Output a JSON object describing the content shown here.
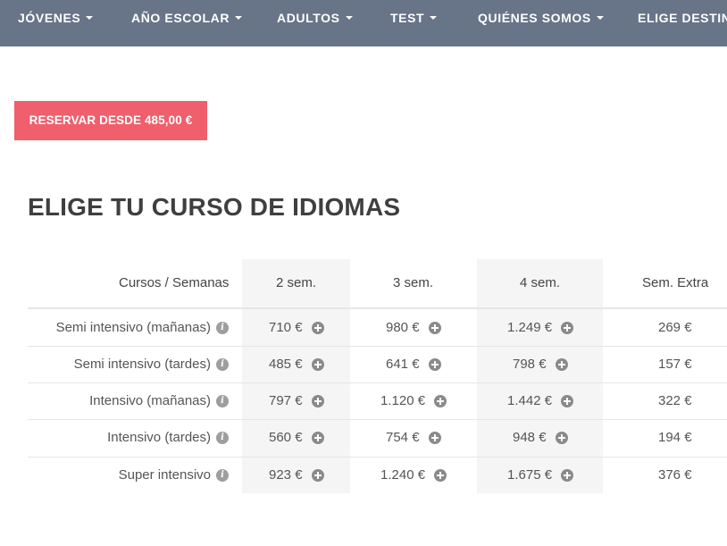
{
  "nav": {
    "items": [
      {
        "label": "JÓVENES"
      },
      {
        "label": "AÑO ESCOLAR"
      },
      {
        "label": "ADULTOS"
      },
      {
        "label": "TEST"
      },
      {
        "label": "QUIÉNES SOMOS"
      },
      {
        "label": "ELIGE DESTINO"
      }
    ]
  },
  "reserve_button": "RESERVAR DESDE 485,00 €",
  "section_title": "ELIGE TU CURSO DE IDIOMAS",
  "table": {
    "headers": [
      "Cursos / Semanas",
      "2 sem.",
      "3 sem.",
      "4 sem.",
      "Sem. Extra"
    ],
    "rows": [
      {
        "course": "Semi intensivo (mañanas)",
        "w2": "710 €",
        "w3": "980 €",
        "w4": "1.249 €",
        "extra": "269 €"
      },
      {
        "course": "Semi intensivo (tardes)",
        "w2": "485 €",
        "w3": "641 €",
        "w4": "798 €",
        "extra": "157 €"
      },
      {
        "course": "Intensivo (mañanas)",
        "w2": "797 €",
        "w3": "1.120 €",
        "w4": "1.442 €",
        "extra": "322 €"
      },
      {
        "course": "Intensivo (tardes)",
        "w2": "560 €",
        "w3": "754 €",
        "w4": "948 €",
        "extra": "194 €"
      },
      {
        "course": "Super intensivo",
        "w2": "923 €",
        "w3": "1.240 €",
        "w4": "1.675 €",
        "extra": "376 €"
      }
    ]
  },
  "icons": {
    "info": "info-circle-icon",
    "add": "plus-circle-icon",
    "caret": "caret-down-icon"
  },
  "colors": {
    "nav_bg": "#687487",
    "button_bg": "#ef5f6c",
    "column_shade": "#f5f5f5"
  }
}
